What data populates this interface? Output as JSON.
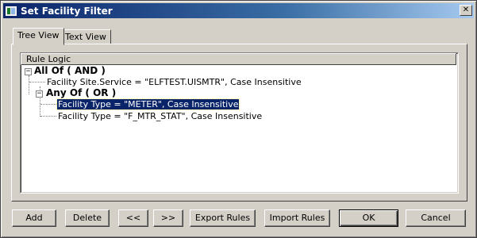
{
  "window": {
    "title": "Set Facility Filter",
    "close_glyph": "✕"
  },
  "tabs": [
    {
      "label": "Tree View",
      "active": true
    },
    {
      "label": "Text View",
      "active": false
    }
  ],
  "tree": {
    "column_header": "Rule Logic",
    "nodes": [
      {
        "label": "All Of ( AND )",
        "expander": "−"
      },
      {
        "label": "Facility Site.Service = \"ELFTEST.UISMTR\", Case Insensitive"
      },
      {
        "label": "Any Of ( OR )",
        "expander": "−"
      },
      {
        "label": "Facility Type = \"METER\", Case Insensitive",
        "selected": true
      },
      {
        "label": "Facility Type = \"F_MTR_STAT\", Case Insensitive"
      }
    ]
  },
  "buttons": {
    "add": "Add",
    "delete": "Delete",
    "move_left": "<<",
    "move_right": ">>",
    "export": "Export Rules",
    "import": "Import Rules",
    "ok": "OK",
    "cancel": "Cancel"
  },
  "colors": {
    "title_bar": "#0a246a",
    "selection": "#0a246a",
    "face": "#d4d0c8"
  }
}
